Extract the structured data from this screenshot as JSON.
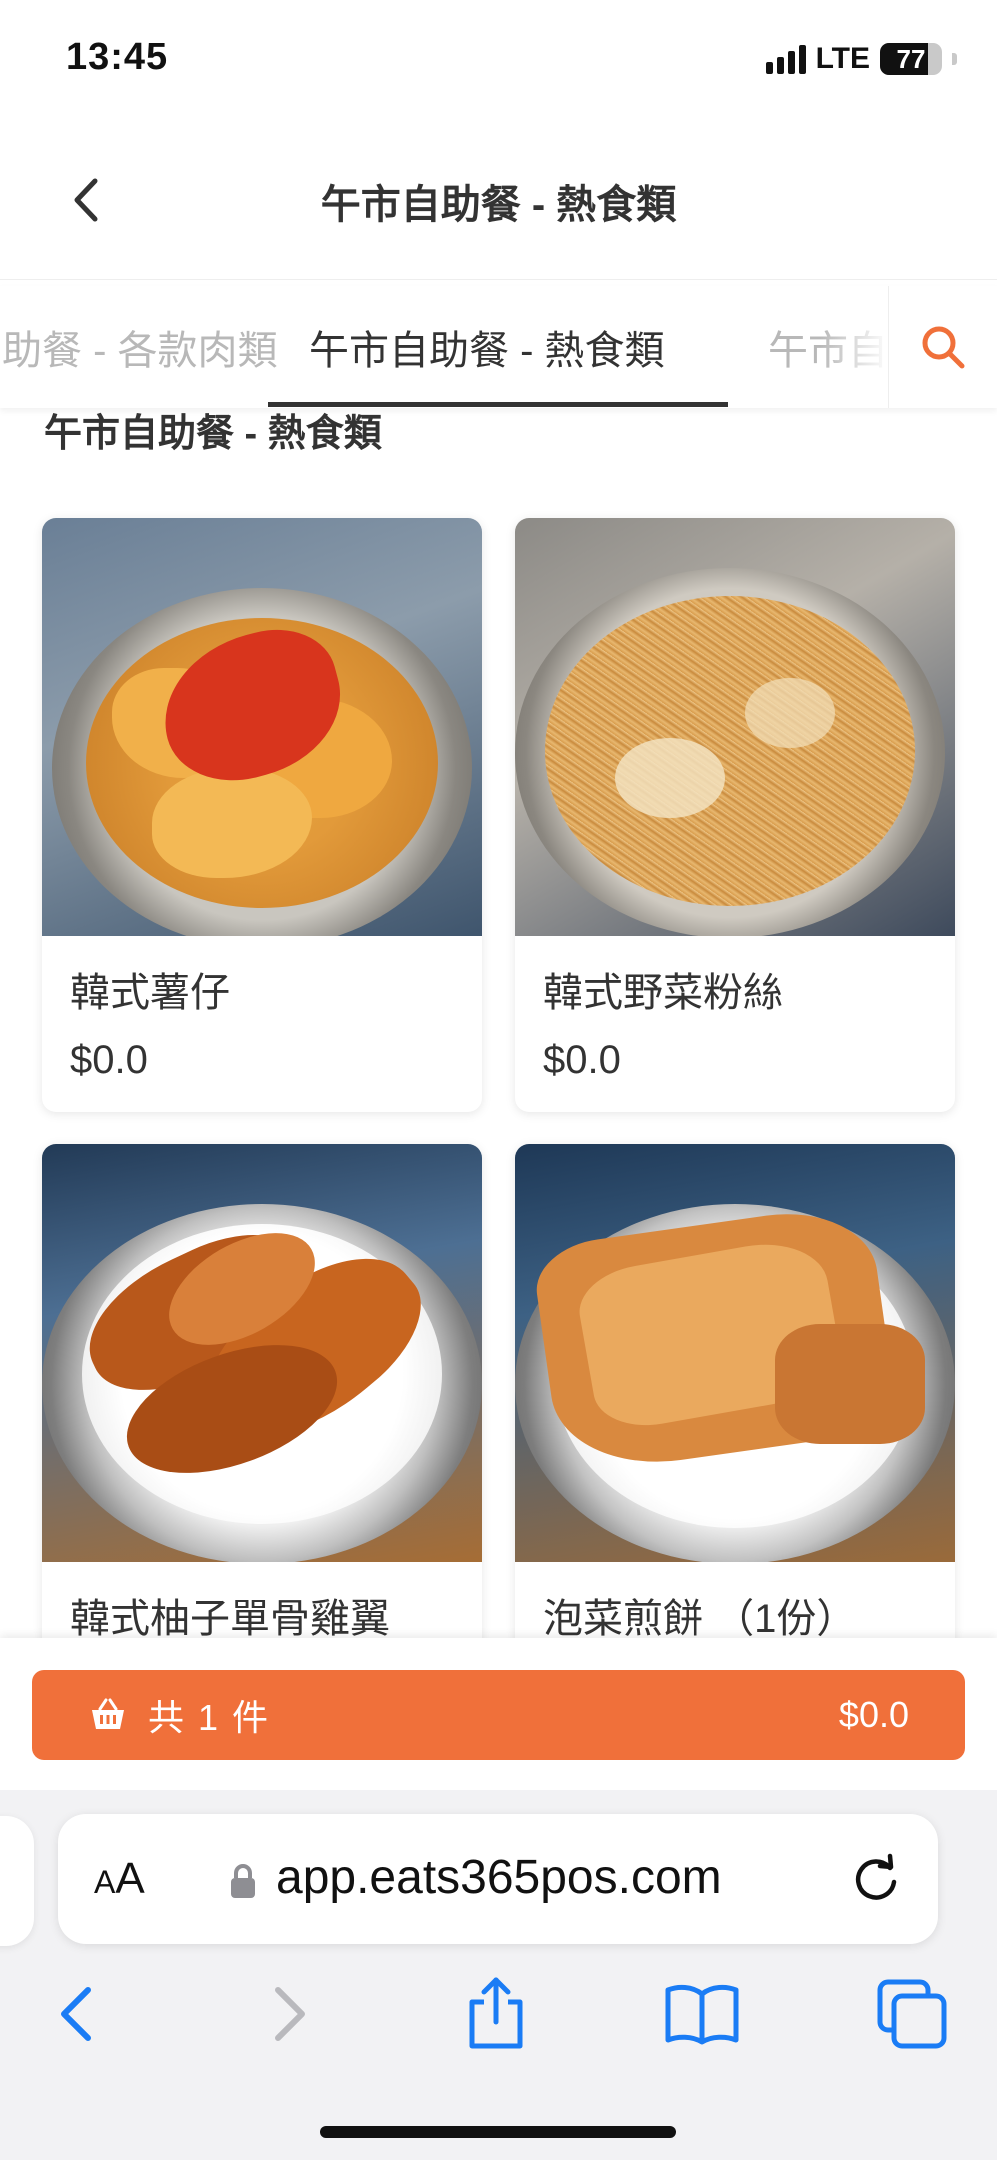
{
  "status_bar": {
    "time": "13:45",
    "network": "LTE",
    "battery": "77",
    "battery_level": 0.77
  },
  "header": {
    "title": "午市自助餐 - 熱食類"
  },
  "tabs": [
    {
      "label": "午市自助餐 - 各款肉類",
      "active": false
    },
    {
      "label": "午市自助餐 - 熱食類",
      "active": true
    },
    {
      "label": "午市自助餐",
      "active": false
    }
  ],
  "section": {
    "title": "午市自助餐 - 熱食類"
  },
  "items": [
    {
      "name": "韓式薯仔",
      "price": "$0.0"
    },
    {
      "name": "韓式野菜粉絲",
      "price": "$0.0"
    },
    {
      "name": "韓式柚子單骨雞翼",
      "price": ""
    },
    {
      "name": "泡菜煎餅 （1份）",
      "price": ""
    }
  ],
  "cart": {
    "count_label": "共 1 件",
    "total": "$0.0"
  },
  "browser": {
    "aa_label": "AA",
    "url": "app.eats365pos.com"
  },
  "colors": {
    "accent": "#f0703a",
    "link_blue": "#1a7cf5"
  }
}
